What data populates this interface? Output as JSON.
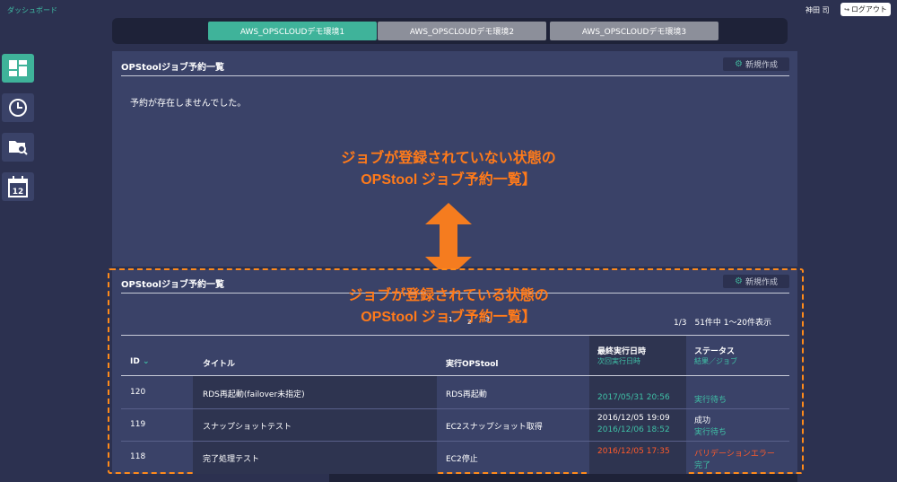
{
  "topbar": {
    "dashboard_link": "ダッシュボード",
    "user_name": "神田 司",
    "logout_label": "ログアウト"
  },
  "env_tabs": [
    {
      "label": "AWS_OPSCLOUDデモ環境1",
      "active": true
    },
    {
      "label": "AWS_OPSCLOUDデモ環境2",
      "active": false
    },
    {
      "label": "AWS_OPSCLOUDデモ環境3",
      "active": false
    }
  ],
  "sidebar": {
    "items": [
      "dashboard-icon",
      "clock-icon",
      "folder-search-icon",
      "calendar-icon"
    ]
  },
  "panel_top": {
    "title": "OPStoolジョブ予約一覧",
    "new_button": "新規作成",
    "empty_message": "予約が存在しませんでした。"
  },
  "annotations": {
    "top_line1": "ジョブが登録されていない状態の",
    "top_line2": "OPStool ジョブ予約一覧】",
    "bottom_line1": "ジョブが登録されている状態の",
    "bottom_line2": "OPStool ジョブ予約一覧】",
    "arrow_color": "#f57c1f"
  },
  "panel_bottom": {
    "title": "OPStoolジョブ予約一覧",
    "new_button": "新規作成",
    "pagination": {
      "page_info": "1/3　51件中 1～20件表示",
      "pages": [
        "1",
        "2",
        "3"
      ]
    },
    "columns": {
      "id": "ID",
      "title": "タイトル",
      "tool": "実行OPStool",
      "last_run": "最終実行日時",
      "next_run": "次回実行日時",
      "status": "ステータス",
      "result": "結果／ジョブ"
    },
    "rows": [
      {
        "id": "120",
        "title": "RDS再起動(failover未指定)",
        "tool": "RDS再起動",
        "last_run": "",
        "next_run": "2017/05/31 20:56",
        "status": "",
        "job": "実行待ち"
      },
      {
        "id": "119",
        "title": "スナップショットテスト",
        "tool": "EC2スナップショット取得",
        "last_run": "2016/12/05 19:09",
        "next_run": "2016/12/06 18:52",
        "status": "成功",
        "job": "実行待ち"
      },
      {
        "id": "118",
        "title": "完了処理テスト",
        "tool": "EC2停止",
        "last_run": "2016/12/05 17:35",
        "next_run": "",
        "status": "バリデーションエラー",
        "job": "完了"
      }
    ]
  },
  "colors": {
    "background": "#2c3150",
    "panel": "#3a4268",
    "accent_green": "#3fb39a",
    "error_red": "#ff5a2a",
    "annotation_orange": "#ff7a1a"
  }
}
